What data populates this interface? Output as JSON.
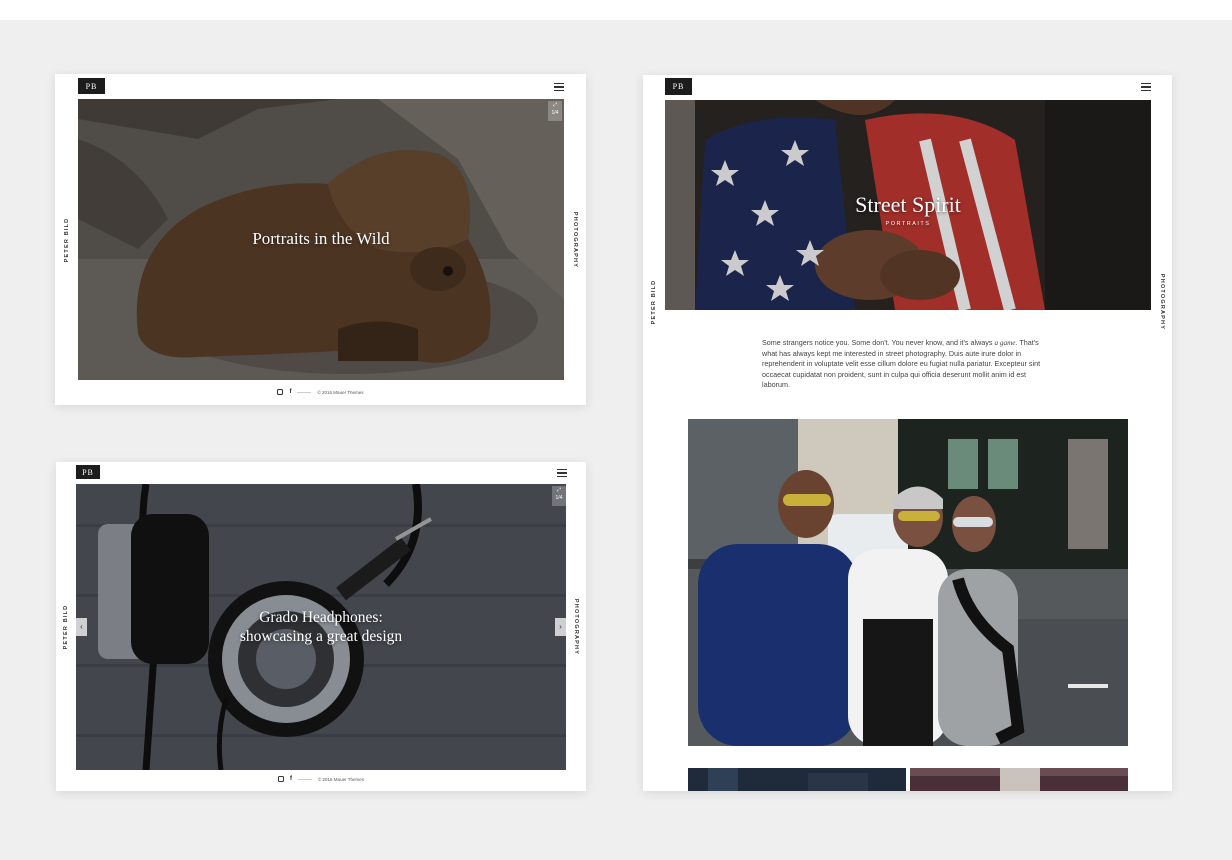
{
  "cards": {
    "bear": {
      "logo": "PB",
      "side_left": "PETER BILD",
      "side_right": "PHOTOGRAPHY",
      "title": "Portraits in the Wild",
      "counter": "1/4",
      "footer_copy": "© 2016 Mauer Themes"
    },
    "headphones": {
      "logo": "PB",
      "side_left": "PETER BILD",
      "side_right": "PHOTOGRAPHY",
      "title": "Grado Headphones: showcasing a great design",
      "counter": "1/4",
      "prev": "‹",
      "next": "›",
      "footer_copy": "© 2016 Mauer Themes"
    },
    "street": {
      "logo": "PB",
      "side_left": "PETER BILD",
      "side_right": "PHOTOGRAPHY",
      "title": "Street Spirit",
      "subtitle": "PORTRAITS",
      "para_before": "Some strangers notice you. Some don't. You never know, and it's always ",
      "para_italic": "a game",
      "para_after": ". That's what has always kept me interested in street photography. Duis aute irure dolor in reprehenderit in voluptate velit esse cillum dolore eu fugiat nulla pariatur. Excepteur sint occaecat cupidatat non proident, sunt in culpa qui officia deserunt mollit anim id est laborum."
    }
  },
  "icons": {
    "instagram": "instagram-icon",
    "facebook": "f",
    "menu": "hamburger-menu-icon",
    "expand": "expand-icon"
  }
}
